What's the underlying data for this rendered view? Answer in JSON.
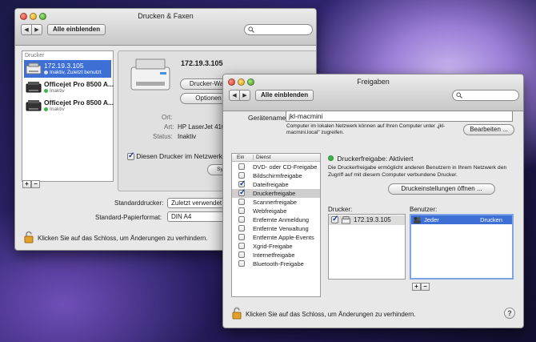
{
  "window1": {
    "title": "Drucken & Faxen",
    "show_all": "Alle einblenden",
    "printers_header": "Drucker",
    "printers": [
      {
        "name": "172.19.3.105",
        "status": "Inaktiv, Zuletzt benutzt",
        "selected": true
      },
      {
        "name": "Officejet Pro 8500 A...",
        "status": "Inaktiv",
        "selected": false
      },
      {
        "name": "Officejet Pro 8500 A...",
        "status": "Inaktiv",
        "selected": false
      }
    ],
    "detail_title": "172.19.3.105",
    "queue_button": "Drucker-Wart",
    "options_button": "Optionen",
    "field_ort": "Ort:",
    "field_art": "Art:",
    "art_value": "HP LaserJet 4100 S",
    "field_status": "Status:",
    "status_value": "Inaktiv",
    "share_checkbox": "Diesen Drucker im Netzwerk fr",
    "sys_button": "Syst",
    "default_printer_label": "Standarddrucker:",
    "default_printer_value": "Zuletzt verwendet",
    "paper_label": "Standard-Papierformat:",
    "paper_value": "DIN A4",
    "lock_text": "Klicken Sie auf das Schloss, um Änderungen zu verhindern."
  },
  "window2": {
    "title": "Freigaben",
    "show_all": "Alle einblenden",
    "device_name_label": "Gerätename:",
    "device_name_value": "jkl-macmini",
    "device_info": "Computer im lokalen Netzwerk können auf Ihren Computer unter „jkl-macmini.local\" zugreifen.",
    "edit_button": "Bearbeiten ...",
    "col_on": "Ein",
    "col_service": "Dienst",
    "services": [
      {
        "label": "DVD- oder CD-Freigabe",
        "on": false
      },
      {
        "label": "Bildschirmfreigabe",
        "on": false
      },
      {
        "label": "Dateifreigabe",
        "on": true
      },
      {
        "label": "Druckerfreigabe",
        "on": true,
        "selected": true
      },
      {
        "label": "Scannerfreigabe",
        "on": false
      },
      {
        "label": "Webfreigabe",
        "on": false
      },
      {
        "label": "Entfernte Anmeldung",
        "on": false
      },
      {
        "label": "Entfernte Verwaltung",
        "on": false
      },
      {
        "label": "Entfernte Apple-Events",
        "on": false
      },
      {
        "label": "Xgrid-Freigabe",
        "on": false
      },
      {
        "label": "Internetfreigabe",
        "on": false
      },
      {
        "label": "Bluetooth-Freigabe",
        "on": false
      }
    ],
    "status_title": "Druckerfreigabe: Aktiviert",
    "status_color": "#3bb44a",
    "status_desc": "Die Druckerfreigabe ermöglicht anderen Benutzern in Ihrem Netzwerk den Zugriff auf mit diesem Computer verbundene Drucker.",
    "print_settings_button": "Druckeinstellungen öffnen ...",
    "printers_label": "Drucker:",
    "printer_row": "172.19.3.105",
    "users_label": "Benutzer:",
    "users": [
      {
        "name": "Jeder",
        "perm": "Drucken"
      }
    ],
    "lock_text": "Klicken Sie auf das Schloss, um Änderungen zu verhindern.",
    "help": "?"
  },
  "colors": {
    "selection": "#3d6fd4",
    "selection_inactive": "#c8c8c8"
  }
}
